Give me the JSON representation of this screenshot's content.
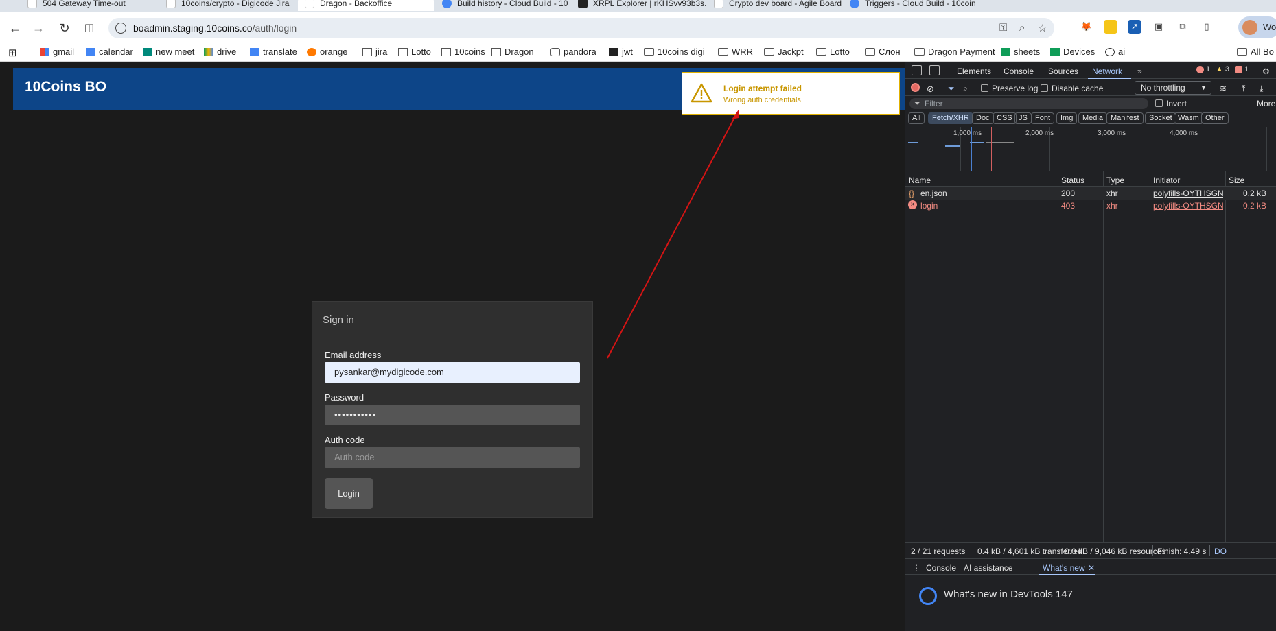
{
  "browser": {
    "tabs": [
      {
        "label": "504 Gateway Time-out",
        "active": false
      },
      {
        "label": "10coins/crypto - Digicode Jira",
        "active": false
      },
      {
        "label": "Dragon - Backoffice",
        "active": true
      },
      {
        "label": "Build history - Cloud Build - 10",
        "active": false
      },
      {
        "label": "XRPL Explorer | rKHSvv93b3s...",
        "active": false
      },
      {
        "label": "Crypto dev board - Agile Board",
        "active": false
      },
      {
        "label": "Triggers - Cloud Build - 10coin",
        "active": false
      }
    ],
    "url_host": "boadmin.staging.10coins.co",
    "url_path": "/auth/login",
    "profile_label": "Wor",
    "bookmarks": [
      {
        "label": "gmail",
        "icon": "gmail-icon"
      },
      {
        "label": "calendar",
        "icon": "calendar-icon"
      },
      {
        "label": "new meet",
        "icon": "meet-icon"
      },
      {
        "label": "drive",
        "icon": "drive-icon"
      },
      {
        "label": "translate",
        "icon": "translate-icon"
      },
      {
        "label": "orange",
        "icon": "orange-icon"
      },
      {
        "label": "jira",
        "icon": "jira-icon"
      },
      {
        "label": "Lotto",
        "icon": "jira-icon"
      },
      {
        "label": "10coins",
        "icon": "jira-icon"
      },
      {
        "label": "Dragon",
        "icon": "jira-icon"
      },
      {
        "label": "pandora",
        "icon": "lock-icon"
      },
      {
        "label": "jwt",
        "icon": "jwt-icon"
      },
      {
        "label": "10coins digi",
        "icon": "folder-icon"
      },
      {
        "label": "WRR",
        "icon": "folder-icon"
      },
      {
        "label": "Jackpt",
        "icon": "folder-icon"
      },
      {
        "label": "Lotto",
        "icon": "folder-icon"
      },
      {
        "label": "Слон",
        "icon": "folder-icon"
      },
      {
        "label": "Dragon Payment",
        "icon": "folder-icon"
      },
      {
        "label": "sheets",
        "icon": "sheets-icon"
      },
      {
        "label": "Devices",
        "icon": "sheets-icon"
      },
      {
        "label": "ai",
        "icon": "openai-icon"
      },
      {
        "label": "All Bo",
        "icon": "folder-icon"
      }
    ]
  },
  "app": {
    "title": "10Coins BO",
    "toast": {
      "title": "Login attempt failed",
      "message": "Wrong auth credentials",
      "color": "#c89600"
    },
    "signin": {
      "heading": "Sign in",
      "email_label": "Email address",
      "email_value": "pysankar@mydigicode.com",
      "password_label": "Password",
      "password_value": "•••••••••••",
      "auth_label": "Auth code",
      "auth_placeholder": "Auth code",
      "login_button": "Login"
    },
    "header_color": "#0d4588"
  },
  "devtools": {
    "tabs": [
      "Elements",
      "Console",
      "Sources",
      "Network"
    ],
    "active_tab": "Network",
    "badges": {
      "errors": "1",
      "warnings": "3",
      "issues": "1"
    },
    "toolbar": {
      "preserve_log": "Preserve log",
      "disable_cache": "Disable cache",
      "throttling": "No throttling"
    },
    "filter_placeholder": "Filter",
    "invert_label": "Invert",
    "more_label": "More",
    "type_filters": [
      "All",
      "Fetch/XHR",
      "Doc",
      "CSS",
      "JS",
      "Font",
      "Img",
      "Media",
      "Manifest",
      "Socket",
      "Wasm",
      "Other"
    ],
    "selected_type": "Fetch/XHR",
    "overview_ticks": [
      "1,000 ms",
      "2,000 ms",
      "3,000 ms",
      "4,000 ms"
    ],
    "columns": [
      "Name",
      "Status",
      "Type",
      "Initiator",
      "Size"
    ],
    "rows": [
      {
        "name": "en.json",
        "status": "200",
        "type": "xhr",
        "initiator": "polyfills-OYTHSGNX",
        "size": "0.2 kB",
        "error": false
      },
      {
        "name": "login",
        "status": "403",
        "type": "xhr",
        "initiator": "polyfills-OYTHSGNX",
        "size": "0.2 kB",
        "error": true
      }
    ],
    "status_bar": {
      "requests": "2 / 21 requests",
      "transferred": "0.4 kB / 4,601 kB transferred",
      "resources": "0.0 kB / 9,046 kB resources",
      "finish": "Finish: 4.49 s",
      "tail": "DO"
    },
    "drawer_tabs": [
      "Console",
      "AI assistance",
      "What's new"
    ],
    "drawer_active": "What's new",
    "whats_new_title": "What's new in DevTools 147"
  }
}
